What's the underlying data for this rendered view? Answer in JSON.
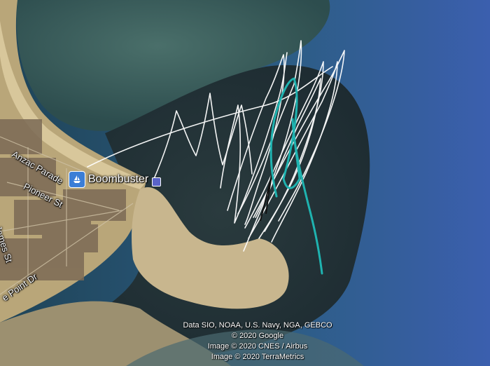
{
  "map": {
    "view": "satellite",
    "place_marker": {
      "name": "Boombuster",
      "icon": "boat-icon",
      "color": "#3b7ed6"
    },
    "streets": [
      {
        "id": "anzac",
        "label": "Anzac Parade"
      },
      {
        "id": "pioneer",
        "label": "Pioneer St"
      },
      {
        "id": "james",
        "label": "James St"
      },
      {
        "id": "point",
        "label": "e Point Dr"
      }
    ],
    "attribution": [
      "Data SIO, NOAA, U.S. Navy, NGA, GEBCO",
      "© 2020 Google",
      "Image © 2020 CNES / Airbus",
      "Image © 2020 TerraMetrics"
    ],
    "track_colors": {
      "white": "#ffffff",
      "teal": "#1fb3b0",
      "dark": "#111111"
    }
  }
}
